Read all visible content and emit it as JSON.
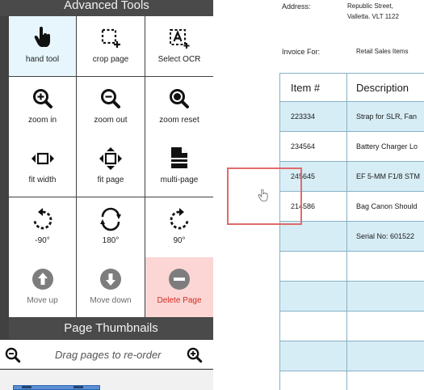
{
  "panel": {
    "title": "Advanced Tools",
    "tools": [
      {
        "label": "hand tool",
        "icon": "hand-icon",
        "state": "active"
      },
      {
        "label": "crop page",
        "icon": "crop-page-icon",
        "state": "normal"
      },
      {
        "label": "Select OCR",
        "icon": "select-ocr-icon",
        "state": "normal"
      },
      {
        "label": "zoom in",
        "icon": "zoom-in-icon",
        "state": "normal"
      },
      {
        "label": "zoom out",
        "icon": "zoom-out-icon",
        "state": "normal"
      },
      {
        "label": "zoom reset",
        "icon": "zoom-reset-icon",
        "state": "normal"
      },
      {
        "label": "fit width",
        "icon": "fit-width-icon",
        "state": "normal"
      },
      {
        "label": "fit page",
        "icon": "fit-page-icon",
        "state": "normal"
      },
      {
        "label": "multi-page",
        "icon": "multi-page-icon",
        "state": "normal"
      },
      {
        "label": "-90°",
        "icon": "rotate-left-icon",
        "state": "normal"
      },
      {
        "label": "180°",
        "icon": "rotate-180-icon",
        "state": "normal"
      },
      {
        "label": "90°",
        "icon": "rotate-right-icon",
        "state": "normal"
      },
      {
        "label": "Move up",
        "icon": "arrow-up-circle-icon",
        "state": "disabled"
      },
      {
        "label": "Move down",
        "icon": "arrow-down-circle-icon",
        "state": "disabled"
      },
      {
        "label": "Delete Page",
        "icon": "minus-circle-icon",
        "state": "danger"
      }
    ],
    "thumbnails": {
      "title": "Page Thumbnails",
      "hint": "Drag pages to re-order"
    }
  },
  "document": {
    "address_label": "Address:",
    "address_lines": [
      "Republic Street,",
      "Valletta. VLT 1122"
    ],
    "invoice_for_label": "Invoice For:",
    "invoice_for_value": "Retail Sales Items",
    "table": {
      "headers": [
        "Item #",
        "Description"
      ],
      "rows": [
        [
          "223334",
          "Strap for SLR, Fan"
        ],
        [
          "234564",
          "Battery Charger Lo"
        ],
        [
          "245645",
          "EF 5-MM F1/8 STM"
        ],
        [
          "214586",
          "Bag Canon Should"
        ],
        [
          "",
          "Serial No: 601522"
        ],
        [
          "",
          ""
        ],
        [
          "",
          ""
        ],
        [
          "",
          ""
        ],
        [
          "",
          ""
        ],
        [
          "",
          ""
        ]
      ]
    }
  },
  "colors": {
    "panel_bg": "#414141",
    "active_tool_bg": "#e6f6fc",
    "danger_tool_bg": "#fbd6d4",
    "danger_text": "#d62a22",
    "table_border": "#86b1c5",
    "table_shade": "#d7edf6",
    "selection_border": "#e06b6b"
  }
}
